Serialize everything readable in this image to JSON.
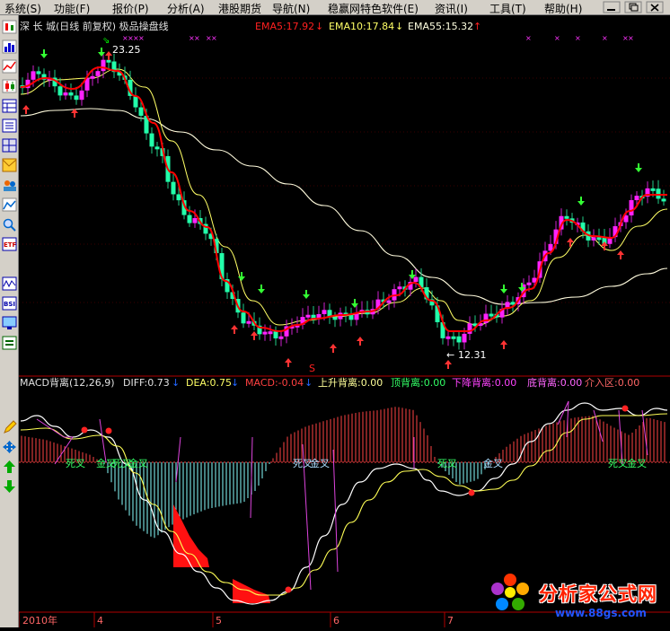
{
  "menu": [
    "系统(S)",
    "功能(F)",
    "报价(P)",
    "分析(A)",
    "港股期货",
    "导航(N)",
    "稳赢网特色软件(E)",
    "资讯(I)",
    "工具(T)",
    "帮助(H)"
  ],
  "window_controls": [
    "minimize",
    "restore",
    "close"
  ],
  "toolbar_icons": [
    "candlestick-icon",
    "bar-chart-icon",
    "line-chart-icon",
    "kline-icon",
    "table-icon",
    "list-icon",
    "grid-icon",
    "mail-icon",
    "users-icon",
    "chart-zoom-icon",
    "magnifier-icon",
    "etf-icon",
    "wave-icon",
    "bsi-icon",
    "monitor-icon",
    "clipboard-icon",
    "pencil-icon",
    "move-arrows-icon",
    "arrow-up-icon",
    "arrow-down-icon"
  ],
  "upper_header": {
    "stock": "深 长 城(日线 前复权) 极品操盘线",
    "ema5": "EMA5:17.92",
    "ema10": "EMA10:17.84",
    "ema55": "EMA55:15.32"
  },
  "lower_header": {
    "name": "MACD背离(12,26,9)",
    "diff": "DIFF:0.73",
    "dea": "DEA:0.75",
    "macd": "MACD:-0.04",
    "up_div": "上升背离:0.00",
    "top_div": "顶背离:0.00",
    "down_div": "下降背离:0.00",
    "bottom_div": "底背离:0.00",
    "entry": "介入区:0.00"
  },
  "price_labels": {
    "high": "23.25",
    "low": "12.31",
    "signal": "S"
  },
  "cross_labels": [
    "死叉",
    "金叉",
    "死叉",
    "金叉",
    "死叉",
    "金叉",
    "死叉",
    "金叉",
    "死叉",
    "金叉"
  ],
  "x_axis": [
    "2010年",
    "4",
    "5",
    "6",
    "7"
  ],
  "watermark": {
    "text": "分析家公式网",
    "url": "www.88gs.com"
  },
  "colors": {
    "up": "#ff00ff",
    "down": "#00ff99",
    "ema5": "#ff0000",
    "ema10": "#ffff66",
    "ema55": "#ffffcc"
  },
  "chart_data": {
    "type": "candlestick",
    "price_high": 23.25,
    "price_low": 12.31,
    "series": [
      {
        "name": "EMA5",
        "last": 17.92
      },
      {
        "name": "EMA10",
        "last": 17.84
      },
      {
        "name": "EMA55",
        "last": 15.32
      }
    ],
    "macd": {
      "params": "12,26,9",
      "diff": 0.73,
      "dea": 0.75,
      "macd": -0.04,
      "上升背离": 0.0,
      "顶背离": 0.0,
      "下降背离": 0.0,
      "底背离": 0.0,
      "介入区": 0.0
    }
  }
}
